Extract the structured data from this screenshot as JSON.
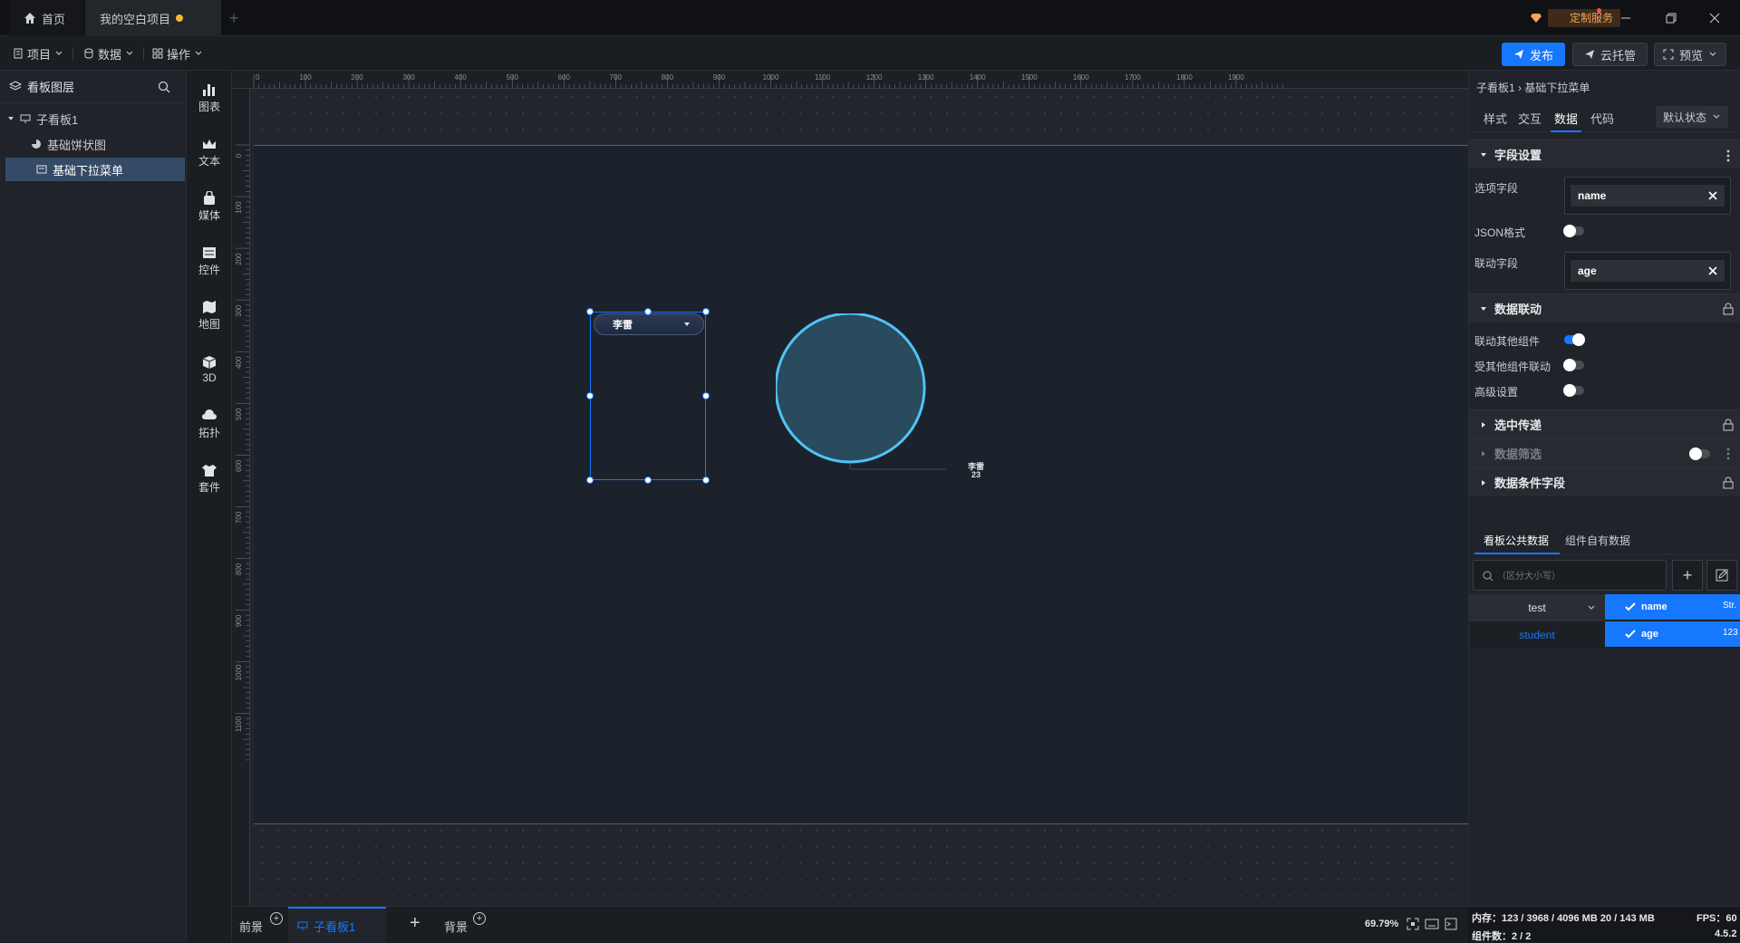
{
  "tabs": {
    "home": "首页",
    "project": "我的空白项目"
  },
  "custom_service": "定制服务",
  "menu": {
    "project": "项目",
    "data": "数据",
    "operation": "操作"
  },
  "toolbar": {
    "publish": "发布",
    "cloud": "云托管",
    "preview": "预览"
  },
  "layers": {
    "title": "看板图层",
    "items": [
      {
        "label": "子看板1"
      },
      {
        "label": "基础饼状图"
      },
      {
        "label": "基础下拉菜单"
      }
    ]
  },
  "components": [
    "图表",
    "文本",
    "媒体",
    "控件",
    "地图",
    "3D",
    "拓扑",
    "套件"
  ],
  "ruler": {
    "top": [
      "0",
      "100",
      "200",
      "300",
      "400",
      "500",
      "600",
      "700",
      "800",
      "900",
      "1000",
      "1100",
      "1200",
      "1300",
      "1400",
      "1500",
      "1600",
      "1700",
      "1800",
      "1900"
    ],
    "left": [
      "0",
      "100",
      "200",
      "300",
      "400",
      "500",
      "600",
      "700",
      "800",
      "900",
      "1000",
      "1100"
    ]
  },
  "canvas": {
    "dropdown_value": "李雷",
    "pie_label": "李雷",
    "pie_value": "23",
    "pie_color": "#2a4a5e",
    "pie_stroke": "#4fc3f7"
  },
  "bottom": {
    "foreground": "前景",
    "subboard": "子看板1",
    "background": "背景",
    "zoom": "69.79%"
  },
  "panel": {
    "breadcrumb": "子看板1 › 基础下拉菜单",
    "tabs": [
      "样式",
      "交互",
      "数据",
      "代码"
    ],
    "state": "默认状态",
    "field_settings": "字段设置",
    "option_field_label": "选项字段",
    "option_field_value": "name",
    "json_label": "JSON格式",
    "link_field_label": "联动字段",
    "link_field_value": "age",
    "data_link": "数据联动",
    "link_other": "联动其他组件",
    "linked_by_other": "受其他组件联动",
    "advanced": "高级设置",
    "selected_pass": "选中传递",
    "data_filter": "数据筛选",
    "condition_field": "数据条件字段",
    "data_tabs": [
      "看板公共数据",
      "组件自有数据"
    ],
    "search_placeholder": "（区分大小写）",
    "datasets": [
      "test",
      "student"
    ],
    "fields": [
      {
        "name": "name",
        "type": "Str."
      },
      {
        "name": "age",
        "type": "123"
      }
    ]
  },
  "status": {
    "memory": "内存：123 / 3968 / 4096 MB  20 / 143 MB",
    "fps": "FPS：60",
    "count": "组件数：2 / 2",
    "version": "4.5.2"
  },
  "colors": {
    "accent": "#1677ff",
    "canvas": "#1c222b"
  }
}
